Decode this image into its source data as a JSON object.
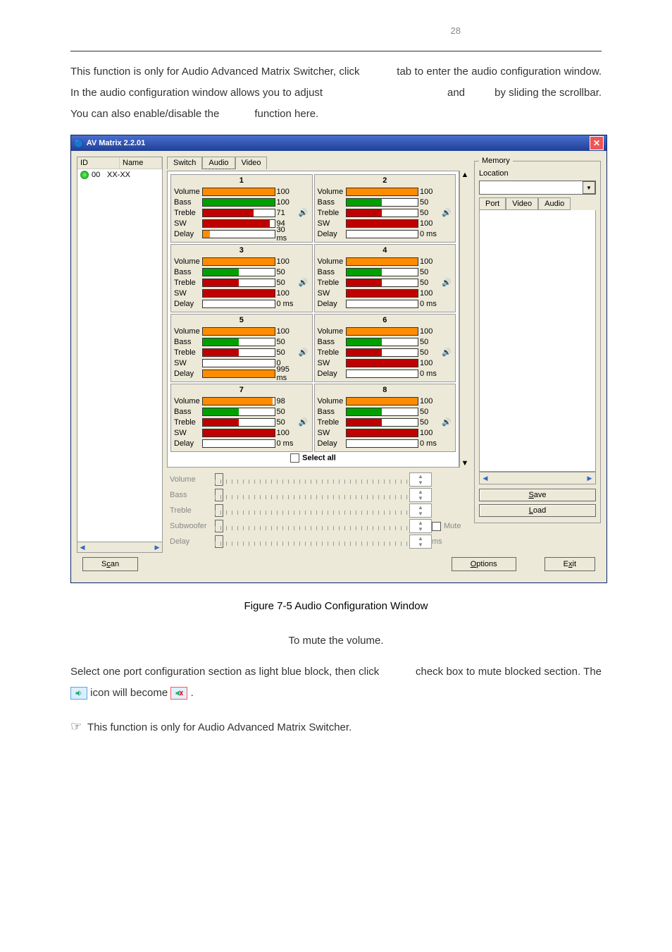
{
  "page_number": "28",
  "para1_a": "This function is only for Audio Advanced Matrix Switcher, click ",
  "para1_b": " tab to enter the audio configuration window. In the audio configuration window allows you to adjust ",
  "para1_c": " and ",
  "para1_d": " by sliding the scrollbar. You can also enable/disable the ",
  "para1_e": " function here.",
  "window_title": "AV Matrix 2.2.01",
  "id_col_id": "ID",
  "id_col_name": "Name",
  "id_row_id": "00",
  "id_row_name": "XX-XX",
  "tab_switch": "Switch",
  "tab_audio": "Audio",
  "tab_video": "Video",
  "channels": [
    {
      "n": "1",
      "volume": "100",
      "bass": "100",
      "treble": "71",
      "sw": "94",
      "delay": "30 ms",
      "vol_w": 100,
      "bass_w": 100,
      "treble_w": 71,
      "sw_w": 94,
      "delay_w": 10
    },
    {
      "n": "2",
      "volume": "100",
      "bass": "50",
      "treble": "50",
      "sw": "100",
      "delay": "0 ms",
      "vol_w": 100,
      "bass_w": 50,
      "treble_w": 50,
      "sw_w": 100,
      "delay_w": 0
    },
    {
      "n": "3",
      "volume": "100",
      "bass": "50",
      "treble": "50",
      "sw": "100",
      "delay": "0 ms",
      "vol_w": 100,
      "bass_w": 50,
      "treble_w": 50,
      "sw_w": 100,
      "delay_w": 0
    },
    {
      "n": "4",
      "volume": "100",
      "bass": "50",
      "treble": "50",
      "sw": "100",
      "delay": "0 ms",
      "vol_w": 100,
      "bass_w": 50,
      "treble_w": 50,
      "sw_w": 100,
      "delay_w": 0
    },
    {
      "n": "5",
      "volume": "100",
      "bass": "50",
      "treble": "50",
      "sw": "0",
      "delay": "995 ms",
      "vol_w": 100,
      "bass_w": 50,
      "treble_w": 50,
      "sw_w": 0,
      "delay_w": 100
    },
    {
      "n": "6",
      "volume": "100",
      "bass": "50",
      "treble": "50",
      "sw": "100",
      "delay": "0 ms",
      "vol_w": 100,
      "bass_w": 50,
      "treble_w": 50,
      "sw_w": 100,
      "delay_w": 0
    },
    {
      "n": "7",
      "volume": "98",
      "bass": "50",
      "treble": "50",
      "sw": "100",
      "delay": "0 ms",
      "vol_w": 98,
      "bass_w": 50,
      "treble_w": 50,
      "sw_w": 100,
      "delay_w": 0
    },
    {
      "n": "8",
      "volume": "100",
      "bass": "50",
      "treble": "50",
      "sw": "100",
      "delay": "0 ms",
      "vol_w": 100,
      "bass_w": 50,
      "treble_w": 50,
      "sw_w": 100,
      "delay_w": 0
    }
  ],
  "lbl_volume": "Volume",
  "lbl_bass": "Bass",
  "lbl_treble": "Treble",
  "lbl_sw": "SW",
  "lbl_delay": "Delay",
  "select_all": "Select all",
  "slider_volume": "Volume",
  "slider_bass": "Bass",
  "slider_treble": "Treble",
  "slider_subwoofer": "Subwoofer",
  "slider_delay": "Delay",
  "mute_label": "Mute",
  "ms_label": "ms",
  "memory_legend": "Memory",
  "location_label": "Location",
  "mem_tab_port": "Port",
  "mem_tab_video": "Video",
  "mem_tab_audio": "Audio",
  "save_label": "Save",
  "load_label": "Load",
  "scan_label": "Scan",
  "options_label": "Options",
  "exit_label": "Exit",
  "figure_caption": "Figure 7-5 Audio Configuration Window",
  "to_mute": "To mute the volume.",
  "para2_a": "Select one port configuration section as light blue block, then click ",
  "para2_b": " check box to mute blocked section. The ",
  "para2_c": " icon will become ",
  "para2_d": ".",
  "para3": "This function is only for Audio Advanced Matrix Switcher.",
  "underline_save": "S",
  "underline_load": "L",
  "underline_scan": "c",
  "underline_options": "O",
  "underline_exit": "x"
}
